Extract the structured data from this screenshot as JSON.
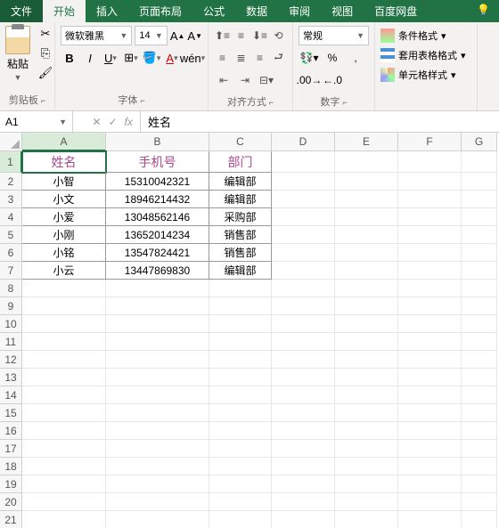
{
  "tabs": {
    "file": "文件",
    "home": "开始",
    "insert": "插入",
    "page_layout": "页面布局",
    "formulas": "公式",
    "data": "数据",
    "review": "审阅",
    "view": "视图",
    "baidu": "百度网盘"
  },
  "ribbon": {
    "clipboard": {
      "paste": "粘贴",
      "label": "剪贴板"
    },
    "font": {
      "name": "微软雅黑",
      "size": "14",
      "label": "字体"
    },
    "alignment": {
      "label": "对齐方式"
    },
    "number": {
      "format": "常规",
      "label": "数字"
    },
    "styles": {
      "conditional": "条件格式",
      "table": "套用表格格式",
      "cell": "单元格样式"
    }
  },
  "formula_bar": {
    "name_box": "A1",
    "fx": "fx",
    "value": "姓名"
  },
  "columns": [
    "A",
    "B",
    "C",
    "D",
    "E",
    "F",
    "G"
  ],
  "rows": [
    "1",
    "2",
    "3",
    "4",
    "5",
    "6",
    "7",
    "8",
    "9",
    "10",
    "11",
    "12",
    "13",
    "14",
    "15",
    "16",
    "17",
    "18",
    "19",
    "20",
    "21"
  ],
  "table": {
    "headers": {
      "name": "姓名",
      "phone": "手机号",
      "dept": "部门"
    },
    "rows": [
      {
        "name": "小智",
        "phone": "15310042321",
        "dept": "编辑部"
      },
      {
        "name": "小文",
        "phone": "18946214432",
        "dept": "编辑部"
      },
      {
        "name": "小爱",
        "phone": "13048562146",
        "dept": "采购部"
      },
      {
        "name": "小刚",
        "phone": "13652014234",
        "dept": "销售部"
      },
      {
        "name": "小铭",
        "phone": "13547824421",
        "dept": "销售部"
      },
      {
        "name": "小云",
        "phone": "13447869830",
        "dept": "编辑部"
      }
    ]
  },
  "selected_cell": "A1"
}
